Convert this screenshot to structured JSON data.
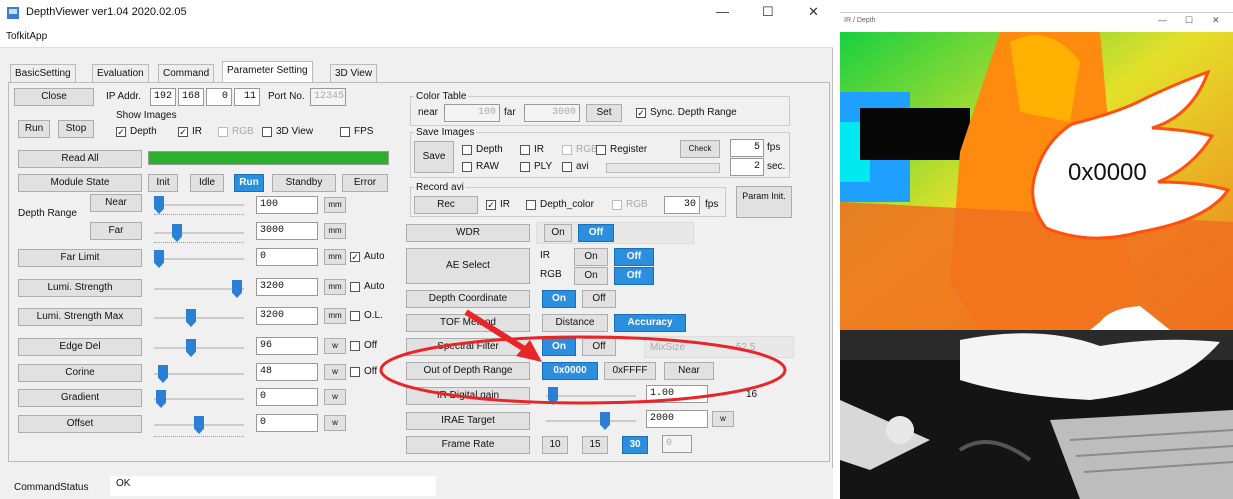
{
  "window": {
    "title": "DepthViewer ver1.04 2020.02.05",
    "minimize": "—",
    "maximize": "☐",
    "close": "✕"
  },
  "menu": {
    "item": "TofkitApp"
  },
  "tabs": [
    "BasicSetting",
    "Evaluation",
    "Command",
    "Parameter Setting",
    "3D View"
  ],
  "connection": {
    "close_label": "Close",
    "ip_label": "IP Addr.",
    "ip": [
      "192",
      "168",
      "0",
      "11"
    ],
    "port_label": "Port No.",
    "port": "12345",
    "run_label": "Run",
    "stop_label": "Stop",
    "show_images_label": "Show Images",
    "show": [
      {
        "label": "Depth",
        "checked": true
      },
      {
        "label": "IR",
        "checked": true
      },
      {
        "label": "RGB",
        "checked": false,
        "disabled": true
      },
      {
        "label": "3D View",
        "checked": false
      },
      {
        "label": "FPS",
        "checked": false
      }
    ]
  },
  "read_all": "Read All",
  "module_state": {
    "label": "Module State",
    "buttons": [
      "Init",
      "Idle",
      "Run",
      "Standby",
      "Error"
    ],
    "active": "Run"
  },
  "depth_range": {
    "label": "Depth Range",
    "near_label": "Near",
    "far_label": "Far",
    "near": "100",
    "far": "3000",
    "unit": "mm"
  },
  "params": [
    {
      "label": "Far Limit",
      "value": "0",
      "unit": "mm",
      "check": "Auto",
      "checked": true
    },
    {
      "label": "Lumi. Strength",
      "value": "3200",
      "unit": "mm",
      "check": "Auto",
      "checked": false
    },
    {
      "label": "Lumi. Strength Max",
      "value": "3200",
      "unit": "mm",
      "check": "O.L.",
      "checked": false
    },
    {
      "label": "Edge Del",
      "value": "96",
      "unit": "w",
      "check": "Off",
      "checked": false
    },
    {
      "label": "Corine",
      "value": "48",
      "unit": "w",
      "check": "Off",
      "checked": false
    },
    {
      "label": "Gradient",
      "value": "0",
      "unit": "w",
      "check": "",
      "checked": false
    },
    {
      "label": "Offset",
      "value": "0",
      "unit": "w",
      "check": "",
      "checked": false
    }
  ],
  "color_table": {
    "title": "Color Table",
    "near_label": "near",
    "near": "100",
    "far_label": "far",
    "far": "3000",
    "set_label": "Set",
    "sync_label": "Sync. Depth Range"
  },
  "save_images": {
    "title": "Save Images",
    "save_label": "Save",
    "depth": "Depth",
    "ir": "IR",
    "rgb": "RGB",
    "register": "Register",
    "check_label": "Check",
    "raw": "RAW",
    "ply": "PLY",
    "avi": "avi",
    "fps_value": "5",
    "fps_unit": "fps",
    "sec_value": "2",
    "sec_unit": "sec."
  },
  "record": {
    "title": "Record avi",
    "rec_label": "Rec",
    "ir": "IR",
    "depth_color": "Depth_color",
    "rgb": "RGB",
    "fps_value": "30",
    "fps_unit": "fps",
    "param_init": "Param Init."
  },
  "wdr": {
    "label": "WDR",
    "on": "On",
    "off": "Off",
    "active": "Off"
  },
  "ae_select": {
    "label": "AE Select",
    "ir": "IR",
    "rgb": "RGB",
    "on": "On",
    "off": "Off"
  },
  "depth_coord": {
    "label": "Depth Coordinate",
    "on": "On",
    "off": "Off",
    "active": "On"
  },
  "tof_method": {
    "label": "TOF Method",
    "distance": "Distance",
    "accuracy": "Accuracy",
    "active": "Accuracy"
  },
  "spectral_filter": {
    "label": "Spectral Filter",
    "on": "On",
    "off": "Off",
    "active": "On",
    "mixsize_label": "MixSize",
    "mixsize": "52.5"
  },
  "out_of_range": {
    "label": "Out of Depth Range",
    "options": [
      "0x0000",
      "0xFFFF",
      "Near"
    ],
    "active": "0x0000"
  },
  "ir_gain": {
    "label": "IR Digital gain",
    "value": "1.00",
    "max": "16"
  },
  "irae_target": {
    "label": "IRAE Target",
    "value": "2000",
    "unit": "w"
  },
  "frame_rate": {
    "label": "Frame Rate",
    "options": [
      "10",
      "15",
      "30"
    ],
    "active": "30",
    "value": "0"
  },
  "status": {
    "label": "CommandStatus",
    "value": "OK"
  },
  "viewer": {
    "title": "IR / Depth",
    "overlay": "0x0000"
  },
  "colors": {
    "accent": "#2b8fe0",
    "annotation": "#e8262a",
    "progress": "#2bb12b"
  }
}
